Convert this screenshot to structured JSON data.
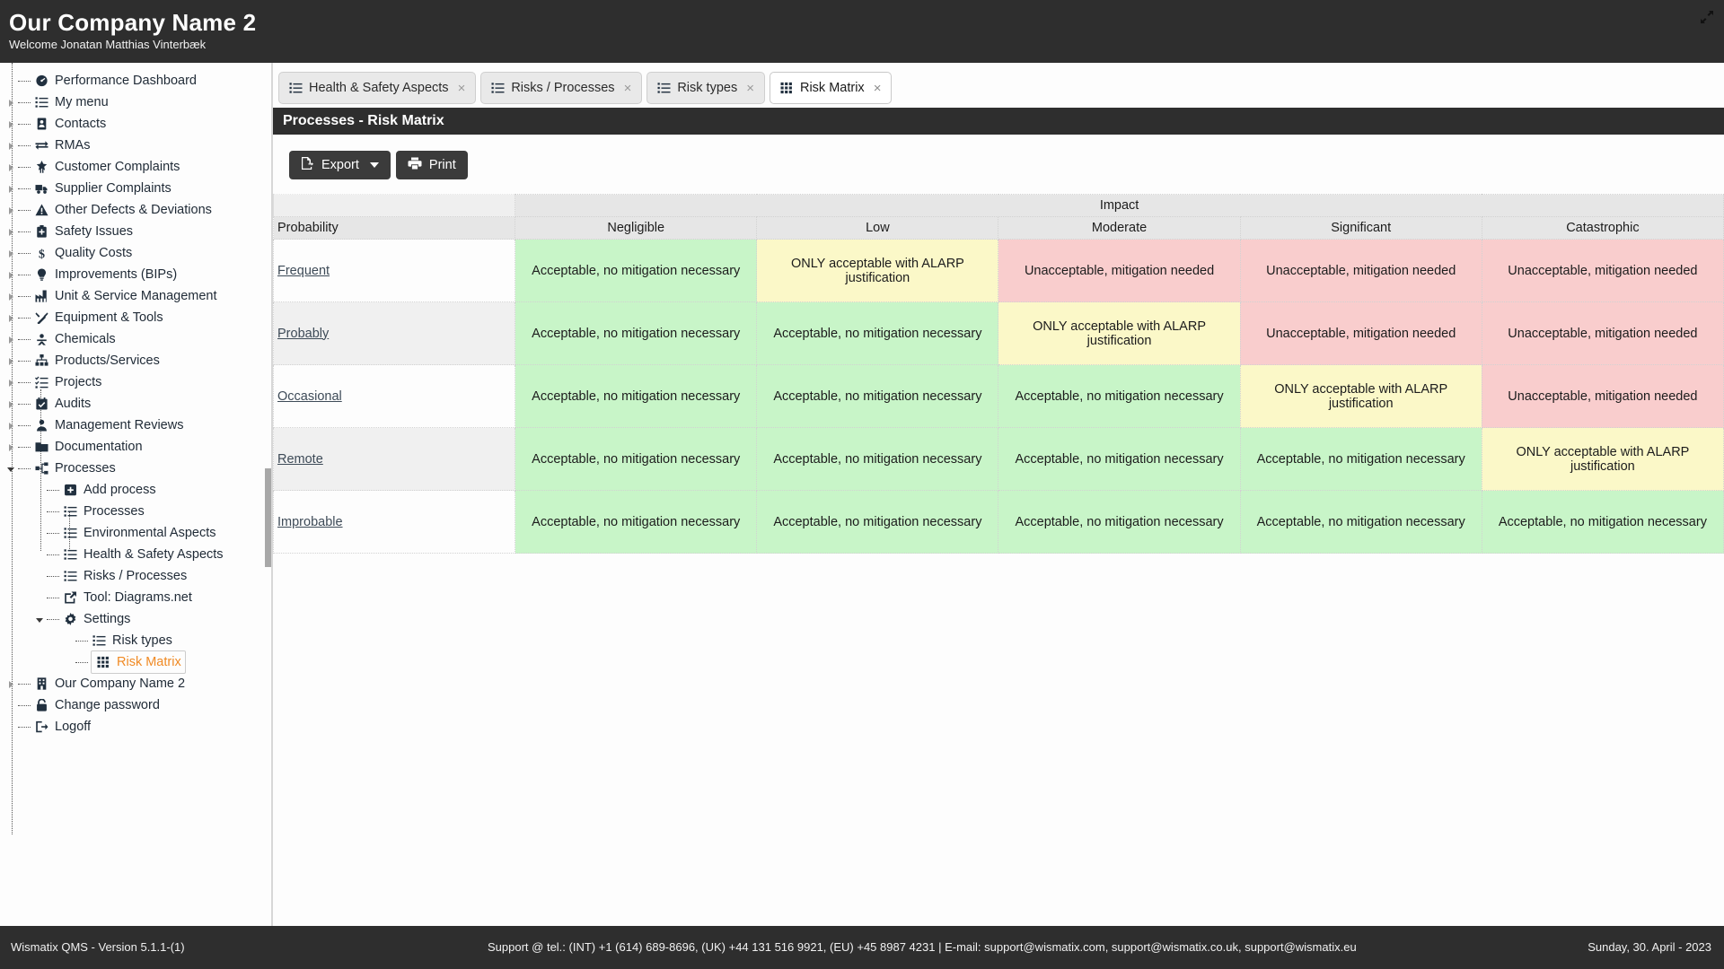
{
  "header": {
    "company": "Our Company Name 2",
    "welcome": "Welcome Jonatan Matthias Vinterbæk",
    "expand_icon": "expand-arrows-icon"
  },
  "sidebar": {
    "items": [
      {
        "label": "Performance Dashboard",
        "icon": "dashboard-icon",
        "level": 0,
        "expandable": false
      },
      {
        "label": "My menu",
        "icon": "list-icon",
        "level": 0,
        "expandable": true
      },
      {
        "label": "Contacts",
        "icon": "contacts-book-icon",
        "level": 0,
        "expandable": true
      },
      {
        "label": "RMAs",
        "icon": "exchange-icon",
        "level": 0,
        "expandable": true
      },
      {
        "label": "Customer Complaints",
        "icon": "star-badge-icon",
        "level": 0,
        "expandable": true
      },
      {
        "label": "Supplier Complaints",
        "icon": "truck-icon",
        "level": 0,
        "expandable": true
      },
      {
        "label": "Other Defects & Deviations",
        "icon": "warning-triangle-icon",
        "level": 0,
        "expandable": true
      },
      {
        "label": "Safety Issues",
        "icon": "first-aid-icon",
        "level": 0,
        "expandable": true
      },
      {
        "label": "Quality Costs",
        "icon": "dollar-icon",
        "level": 0,
        "expandable": true
      },
      {
        "label": "Improvements (BIPs)",
        "icon": "lightbulb-icon",
        "level": 0,
        "expandable": true
      },
      {
        "label": "Unit & Service Management",
        "icon": "factory-icon",
        "level": 0,
        "expandable": true
      },
      {
        "label": "Equipment & Tools",
        "icon": "tools-icon",
        "level": 0,
        "expandable": true
      },
      {
        "label": "Chemicals",
        "icon": "hazard-icon",
        "level": 0,
        "expandable": true
      },
      {
        "label": "Products/Services",
        "icon": "sitemap-icon",
        "level": 0,
        "expandable": true
      },
      {
        "label": "Projects",
        "icon": "tasks-icon",
        "level": 0,
        "expandable": true
      },
      {
        "label": "Audits",
        "icon": "calendar-check-icon",
        "level": 0,
        "expandable": true
      },
      {
        "label": "Management Reviews",
        "icon": "users-icon",
        "level": 0,
        "expandable": true
      },
      {
        "label": "Documentation",
        "icon": "folder-icon",
        "level": 0,
        "expandable": true
      },
      {
        "label": "Processes",
        "icon": "process-tree-icon",
        "level": 0,
        "expandable": true,
        "expanded": true
      },
      {
        "label": "Add process",
        "icon": "plus-square-icon",
        "level": 1,
        "expandable": false
      },
      {
        "label": "Processes",
        "icon": "list-icon",
        "level": 1,
        "expandable": false
      },
      {
        "label": "Environmental Aspects",
        "icon": "list-icon",
        "level": 1,
        "expandable": false
      },
      {
        "label": "Health & Safety Aspects",
        "icon": "list-icon",
        "level": 1,
        "expandable": false
      },
      {
        "label": "Risks / Processes",
        "icon": "list-icon",
        "level": 1,
        "expandable": false
      },
      {
        "label": "Tool: Diagrams.net",
        "icon": "external-link-icon",
        "level": 1,
        "expandable": false
      },
      {
        "label": "Settings",
        "icon": "gear-icon",
        "level": 1,
        "expandable": true,
        "expanded": true
      },
      {
        "label": "Risk types",
        "icon": "list-icon",
        "level": 2,
        "expandable": false
      },
      {
        "label": "Risk Matrix",
        "icon": "grid-icon",
        "level": 2,
        "expandable": false,
        "selected": true
      },
      {
        "label": "Our Company Name 2",
        "icon": "building-icon",
        "level": 0,
        "expandable": true
      },
      {
        "label": "Change password",
        "icon": "lock-icon",
        "level": 0,
        "expandable": false
      },
      {
        "label": "Logoff",
        "icon": "sign-out-icon",
        "level": 0,
        "expandable": false
      }
    ]
  },
  "tabs": [
    {
      "label": "Health & Safety Aspects",
      "icon": "list-icon",
      "active": false,
      "close": "×"
    },
    {
      "label": "Risks / Processes",
      "icon": "list-icon",
      "active": false,
      "close": "×"
    },
    {
      "label": "Risk types",
      "icon": "list-icon",
      "active": false,
      "close": "×"
    },
    {
      "label": "Risk Matrix",
      "icon": "grid-icon",
      "active": true,
      "close": "×"
    }
  ],
  "page": {
    "title": "Processes - Risk Matrix"
  },
  "toolbar": {
    "export_label": "Export",
    "export_icon": "export-file-icon",
    "print_label": "Print",
    "print_icon": "printer-icon"
  },
  "chart_data": {
    "type": "heatmap",
    "title": "Processes - Risk Matrix",
    "xlabel": "Impact",
    "ylabel": "Probability",
    "categories": [
      "Negligible",
      "Low",
      "Moderate",
      "Significant",
      "Catastrophic"
    ],
    "rows": [
      "Frequent",
      "Probably",
      "Occasional",
      "Remote",
      "Improbable"
    ],
    "legend": [
      {
        "name": "Acceptable, no mitigation necessary",
        "color": "#c8f5c8",
        "class": "c-green"
      },
      {
        "name": "ONLY acceptable with ALARP justification",
        "color": "#fbf8c8",
        "class": "c-yellow"
      },
      {
        "name": "Unacceptable, mitigation needed",
        "color": "#f9cdcd",
        "class": "c-red"
      }
    ],
    "cells": [
      [
        {
          "text": "Acceptable, no mitigation necessary",
          "class": "c-green"
        },
        {
          "text": "ONLY acceptable with ALARP justification",
          "class": "c-yellow"
        },
        {
          "text": "Unacceptable, mitigation needed",
          "class": "c-red"
        },
        {
          "text": "Unacceptable, mitigation needed",
          "class": "c-red"
        },
        {
          "text": "Unacceptable, mitigation needed",
          "class": "c-red"
        }
      ],
      [
        {
          "text": "Acceptable, no mitigation necessary",
          "class": "c-green"
        },
        {
          "text": "Acceptable, no mitigation necessary",
          "class": "c-green"
        },
        {
          "text": "ONLY acceptable with ALARP justification",
          "class": "c-yellow"
        },
        {
          "text": "Unacceptable, mitigation needed",
          "class": "c-red"
        },
        {
          "text": "Unacceptable, mitigation needed",
          "class": "c-red"
        }
      ],
      [
        {
          "text": "Acceptable, no mitigation necessary",
          "class": "c-green"
        },
        {
          "text": "Acceptable, no mitigation necessary",
          "class": "c-green"
        },
        {
          "text": "Acceptable, no mitigation necessary",
          "class": "c-green"
        },
        {
          "text": "ONLY acceptable with ALARP justification",
          "class": "c-yellow"
        },
        {
          "text": "Unacceptable, mitigation needed",
          "class": "c-red"
        }
      ],
      [
        {
          "text": "Acceptable, no mitigation necessary",
          "class": "c-green"
        },
        {
          "text": "Acceptable, no mitigation necessary",
          "class": "c-green"
        },
        {
          "text": "Acceptable, no mitigation necessary",
          "class": "c-green"
        },
        {
          "text": "Acceptable, no mitigation necessary",
          "class": "c-green"
        },
        {
          "text": "ONLY acceptable with ALARP justification",
          "class": "c-yellow"
        }
      ],
      [
        {
          "text": "Acceptable, no mitigation necessary",
          "class": "c-green"
        },
        {
          "text": "Acceptable, no mitigation necessary",
          "class": "c-green"
        },
        {
          "text": "Acceptable, no mitigation necessary",
          "class": "c-green"
        },
        {
          "text": "Acceptable, no mitigation necessary",
          "class": "c-green"
        },
        {
          "text": "Acceptable, no mitigation necessary",
          "class": "c-green"
        }
      ]
    ]
  },
  "footer": {
    "left": "Wismatix QMS - Version 5.1.1-(1)",
    "middle": "Support @ tel.: (INT) +1 (614) 689-8696, (UK) +44 131 516 9921, (EU) +45 8987 4231 | E-mail: support@wismatix.com, support@wismatix.co.uk, support@wismatix.eu",
    "right": "Sunday, 30. April - 2023"
  }
}
